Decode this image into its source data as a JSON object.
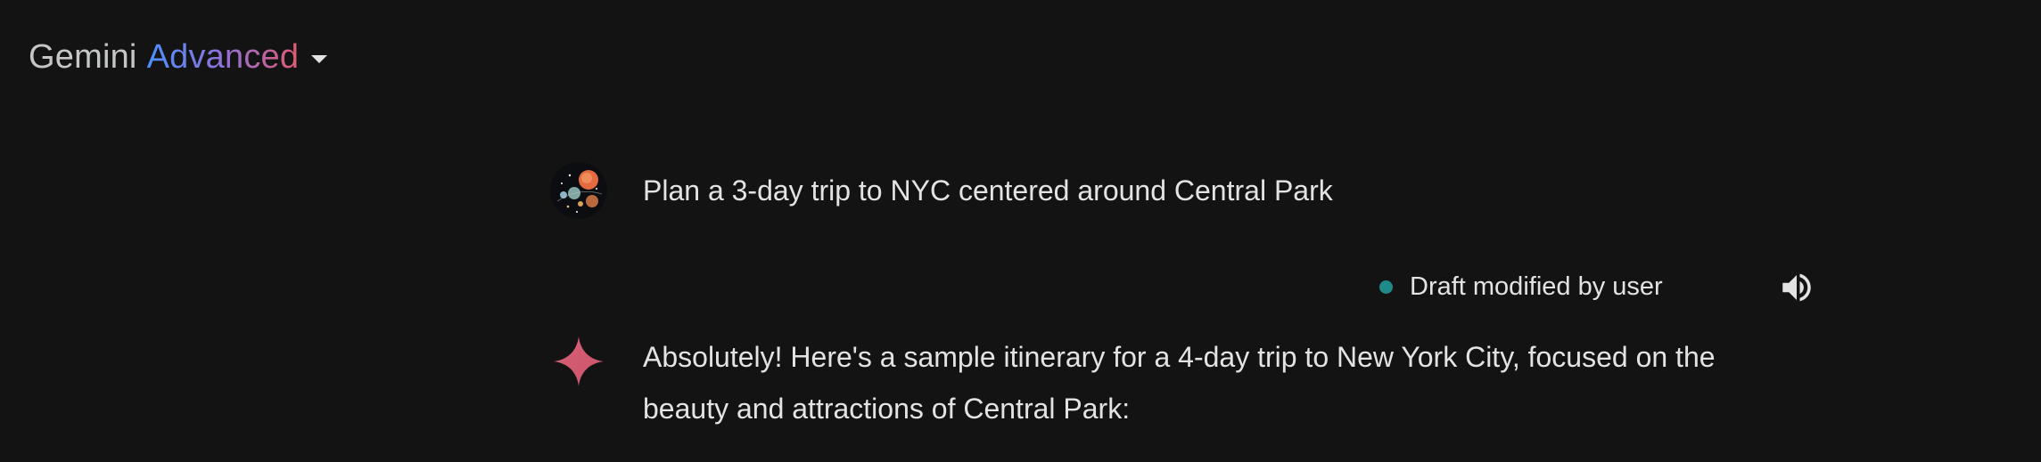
{
  "header": {
    "brand_name": "Gemini",
    "tier": "Advanced",
    "dropdown_icon": "caret-down-icon"
  },
  "user_prompt": {
    "avatar": "user-avatar",
    "text": "Plan a 3-day trip to NYC centered around Central Park"
  },
  "draft_status": {
    "indicator_color": "#1f8a8a",
    "text": "Draft modified by user",
    "speaker_icon": "speaker-icon"
  },
  "response": {
    "icon": "gemini-sparkle-icon",
    "text": "Absolutely! Here's a sample itinerary for a 4-day trip to New York City, focused on the beauty and attractions of Central Park:"
  },
  "colors": {
    "background": "#131314",
    "text": "#e3e3e3",
    "brand_gradient": [
      "#4b90ff",
      "#8f72d8",
      "#e05a72"
    ]
  }
}
